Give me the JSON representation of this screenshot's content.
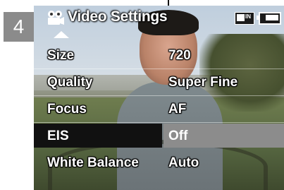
{
  "step_badge": "4",
  "header": {
    "title": "Video Settings",
    "icons": {
      "mode": "video-camera-icon",
      "storage": "internal-memory-icon",
      "battery": "battery-icon"
    },
    "storage_label": "IN"
  },
  "menu": {
    "items": [
      {
        "label": "Size",
        "value": "720",
        "selected": false
      },
      {
        "label": "Quality",
        "value": "Super Fine",
        "selected": false
      },
      {
        "label": "Focus",
        "value": "AF",
        "selected": false
      },
      {
        "label": "EIS",
        "value": "Off",
        "selected": true
      },
      {
        "label": "White Balance",
        "value": "Auto",
        "selected": false
      }
    ]
  },
  "colors": {
    "badge": "#8b8b8b",
    "selected_label_bg": "#111111",
    "selected_value_bg": "#8c8c8c"
  }
}
